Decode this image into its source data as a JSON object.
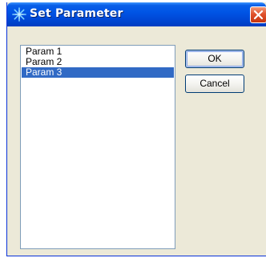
{
  "window": {
    "title": "Set Parameter",
    "title_icon": "asterisk-burst-icon",
    "close_icon": "close-x-icon",
    "accent_color": "#0055e5",
    "close_color": "#e0522c"
  },
  "params_list": {
    "items": [
      {
        "label": "Param 1",
        "selected": false
      },
      {
        "label": "Param 2",
        "selected": false
      },
      {
        "label": "Param 3",
        "selected": true
      }
    ],
    "selection_color": "#316ac5"
  },
  "buttons": {
    "ok_label": "OK",
    "cancel_label": "Cancel"
  }
}
